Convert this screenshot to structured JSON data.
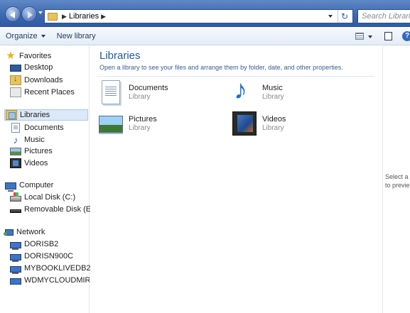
{
  "address": {
    "crumbs": [
      "Libraries"
    ]
  },
  "search": {
    "placeholder": "Search Libraries"
  },
  "toolbar": {
    "organize": "Organize",
    "new_library": "New library"
  },
  "nav": {
    "favorites": "Favorites",
    "desktop": "Desktop",
    "downloads": "Downloads",
    "recent_places": "Recent Places",
    "libraries": "Libraries",
    "documents": "Documents",
    "music": "Music",
    "pictures": "Pictures",
    "videos": "Videos",
    "computer": "Computer",
    "local_disk": "Local Disk (C:)",
    "removable_disk": "Removable Disk (E:)",
    "network": "Network",
    "net1": "DORISB2",
    "net2": "DORISN900C",
    "net3": "MYBOOKLIVEDB2",
    "net4": "WDMYCLOUDMIRR"
  },
  "main": {
    "title": "Libraries",
    "subtitle": "Open a library to see your files and arrange them by folder, date, and other properties.",
    "libraries": [
      {
        "name": "Documents",
        "kind": "Library"
      },
      {
        "name": "Music",
        "kind": "Library"
      },
      {
        "name": "Pictures",
        "kind": "Library"
      },
      {
        "name": "Videos",
        "kind": "Library"
      }
    ]
  },
  "preview": {
    "line1": "Select a f",
    "line2": "to previe"
  },
  "colors": {
    "accent": "#1e5aa8",
    "titlebar": "#3c67b1"
  }
}
